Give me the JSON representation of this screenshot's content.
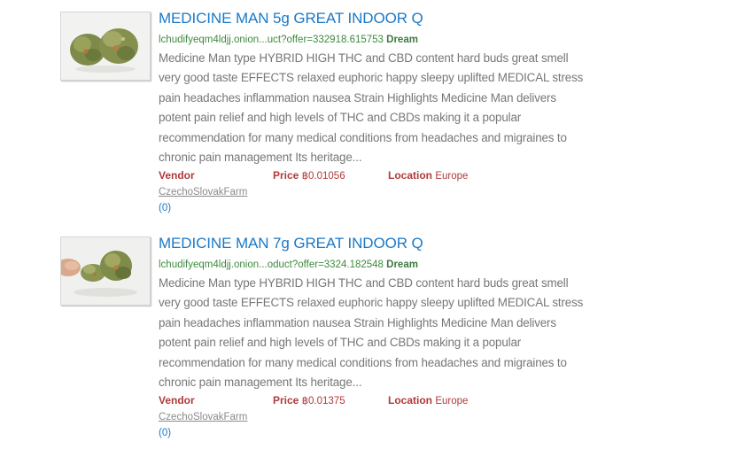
{
  "results": [
    {
      "title": "MEDICINE MAN 5g GREAT INDOOR Q",
      "url": "lchudifyeqm4ldjj.onion...uct?offer=332918.615753",
      "market": "Dream",
      "description": "Medicine Man type HYBRID HIGH THC and CBD content hard buds great smell very good taste EFFECTS relaxed euphoric happy sleepy uplifted MEDICAL stress pain headaches inflammation nausea Strain Highlights Medicine Man delivers potent pain relief and high levels of THC and CBDs making it a popular recommendation for many medical conditions from headaches and migraines to chronic pain management Its heritage...",
      "vendor_label": "Vendor",
      "price_label": "Price",
      "price": "฿0.01056",
      "location_label": "Location",
      "location": "Europe",
      "vendor_name": "CzechoSlovakFarm",
      "feedback": "(0)",
      "thumbnail_icon": "cannabis-bud-photo"
    },
    {
      "title": "MEDICINE MAN 7g GREAT INDOOR Q",
      "url": "lchudifyeqm4ldjj.onion...oduct?offer=3324.182548",
      "market": "Dream",
      "description": "Medicine Man type HYBRID HIGH THC and CBD content hard buds great smell very good taste EFFECTS relaxed euphoric happy sleepy uplifted MEDICAL stress pain headaches inflammation nausea Strain Highlights Medicine Man delivers potent pain relief and high levels of THC and CBDs making it a popular recommendation for many medical conditions from headaches and migraines to chronic pain management Its heritage...",
      "vendor_label": "Vendor",
      "price_label": "Price",
      "price": "฿0.01375",
      "location_label": "Location",
      "location": "Europe",
      "vendor_name": "CzechoSlovakFarm",
      "feedback": "(0)",
      "thumbnail_icon": "cannabis-bud-in-hand-photo"
    }
  ],
  "colors": {
    "title": "#1a79c8",
    "url": "#3e8a3e",
    "description": "#777777",
    "meta_label": "#b03a3a",
    "vendor_link": "#8a8a8a"
  }
}
